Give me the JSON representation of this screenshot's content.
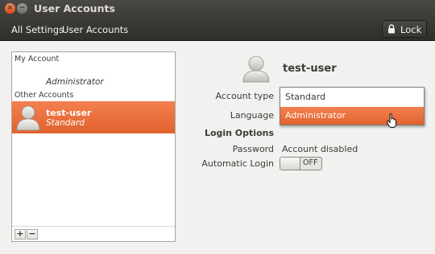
{
  "window": {
    "title": "User Accounts",
    "controls": {
      "close_icon": "×",
      "minimize_icon": "−"
    }
  },
  "toolbar": {
    "breadcrumbs": [
      "All Settings",
      "User Accounts"
    ],
    "lock_label": "Lock",
    "lock_icon": "lock-icon"
  },
  "user_list": {
    "my_account_label": "My Account",
    "my_account_role": "Administrator",
    "other_accounts_label": "Other Accounts",
    "selected_user": {
      "name": "test-user",
      "role": "Standard"
    },
    "add_label": "+",
    "remove_label": "−"
  },
  "details": {
    "username": "test-user",
    "account_type_label": "Account type",
    "account_type_options": [
      "Standard",
      "Administrator"
    ],
    "account_type_highlighted": "Administrator",
    "language_label": "Language",
    "login_options_heading": "Login Options",
    "password_label": "Password",
    "password_value": "Account disabled",
    "automatic_login_label": "Automatic Login",
    "automatic_login_state": "OFF"
  },
  "colors": {
    "accent": "#e1622e",
    "titlebar": "#3c3b37",
    "background": "#f2f1f0"
  }
}
